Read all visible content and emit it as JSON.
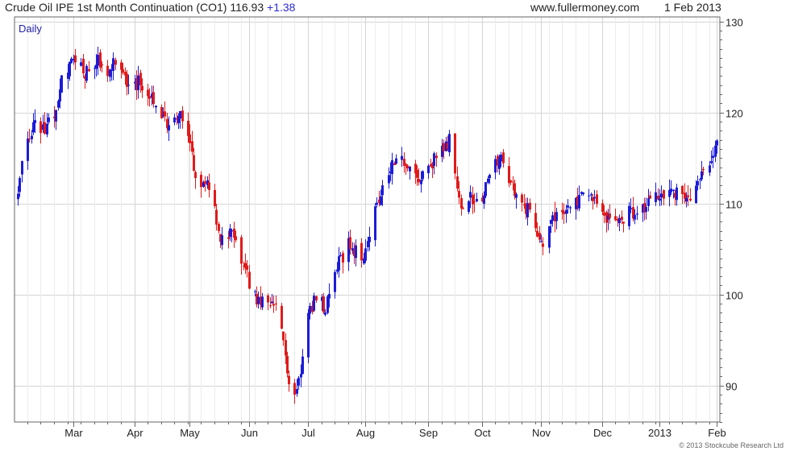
{
  "header": {
    "title": "Crude Oil IPE 1st Month Continuation (CO1) 116.93",
    "change": "+1.38",
    "site": "www.fullermoney.com",
    "date": "1 Feb 2013"
  },
  "footer": {
    "copyright": "© 2013 Stockcube Research Ltd"
  },
  "colors": {
    "up": "#1c1cd8",
    "down": "#e01b1b",
    "grid": "#d4d4d4",
    "frame": "#666666"
  },
  "chart_data": {
    "type": "candlestick",
    "period_label": "Daily",
    "xlabel": "",
    "ylabel": "",
    "ylim": [
      86,
      130.5
    ],
    "yticks": [
      90,
      100,
      110,
      120,
      130
    ],
    "y_axis_side": "right",
    "grid": true,
    "start_date": "2012-02-01",
    "end_date": "2013-02-01",
    "x_tick_labels": [
      {
        "label": "Mar",
        "date": "2012-03-01"
      },
      {
        "label": "Apr",
        "date": "2012-04-02"
      },
      {
        "label": "May",
        "date": "2012-05-01"
      },
      {
        "label": "Jun",
        "date": "2012-06-01"
      },
      {
        "label": "Jul",
        "date": "2012-07-02"
      },
      {
        "label": "Aug",
        "date": "2012-08-01"
      },
      {
        "label": "Sep",
        "date": "2012-09-03"
      },
      {
        "label": "Oct",
        "date": "2012-10-01"
      },
      {
        "label": "Nov",
        "date": "2012-11-01"
      },
      {
        "label": "Dec",
        "date": "2012-12-03"
      },
      {
        "label": "2013",
        "date": "2013-01-02"
      },
      {
        "label": "Feb",
        "date": "2013-02-01"
      }
    ],
    "close_path": [
      [
        "2012-02-01",
        111.5
      ],
      [
        "2012-02-06",
        117.5
      ],
      [
        "2012-02-10",
        118.6
      ],
      [
        "2012-02-15",
        118.0
      ],
      [
        "2012-02-20",
        120.0
      ],
      [
        "2012-02-24",
        123.5
      ],
      [
        "2012-03-01",
        126.5
      ],
      [
        "2012-03-07",
        124.0
      ],
      [
        "2012-03-13",
        126.0
      ],
      [
        "2012-03-19",
        124.5
      ],
      [
        "2012-03-23",
        125.5
      ],
      [
        "2012-03-30",
        122.5
      ],
      [
        "2012-04-05",
        123.5
      ],
      [
        "2012-04-12",
        121.0
      ],
      [
        "2012-04-19",
        118.5
      ],
      [
        "2012-04-27",
        119.8
      ],
      [
        "2012-05-04",
        113.0
      ],
      [
        "2012-05-11",
        112.0
      ],
      [
        "2012-05-17",
        106.5
      ],
      [
        "2012-05-24",
        106.5
      ],
      [
        "2012-05-31",
        102.0
      ],
      [
        "2012-06-05",
        99.0
      ],
      [
        "2012-06-12",
        99.5
      ],
      [
        "2012-06-18",
        97.0
      ],
      [
        "2012-06-22",
        90.5
      ],
      [
        "2012-06-25",
        89.2
      ],
      [
        "2012-06-28",
        91.5
      ],
      [
        "2012-07-02",
        97.5
      ],
      [
        "2012-07-06",
        100.0
      ],
      [
        "2012-07-11",
        98.5
      ],
      [
        "2012-07-17",
        103.0
      ],
      [
        "2012-07-23",
        105.5
      ],
      [
        "2012-07-30",
        104.0
      ],
      [
        "2012-08-03",
        107.0
      ],
      [
        "2012-08-09",
        111.5
      ],
      [
        "2012-08-16",
        115.0
      ],
      [
        "2012-08-23",
        114.5
      ],
      [
        "2012-08-29",
        112.5
      ],
      [
        "2012-09-05",
        114.5
      ],
      [
        "2012-09-11",
        116.0
      ],
      [
        "2012-09-14",
        117.0
      ],
      [
        "2012-09-19",
        110.0
      ],
      [
        "2012-09-25",
        110.5
      ],
      [
        "2012-10-02",
        111.0
      ],
      [
        "2012-10-08",
        115.0
      ],
      [
        "2012-10-12",
        114.5
      ],
      [
        "2012-10-19",
        111.0
      ],
      [
        "2012-10-26",
        109.0
      ],
      [
        "2012-11-02",
        105.5
      ],
      [
        "2012-11-09",
        109.0
      ],
      [
        "2012-11-15",
        109.5
      ],
      [
        "2012-11-21",
        110.5
      ],
      [
        "2012-11-28",
        110.8
      ],
      [
        "2012-12-05",
        108.5
      ],
      [
        "2012-12-11",
        108.0
      ],
      [
        "2012-12-17",
        109.0
      ],
      [
        "2012-12-24",
        109.5
      ],
      [
        "2012-12-31",
        111.0
      ],
      [
        "2013-01-07",
        111.5
      ],
      [
        "2013-01-14",
        111.0
      ],
      [
        "2013-01-18",
        110.5
      ],
      [
        "2013-01-23",
        112.5
      ],
      [
        "2013-01-28",
        114.0
      ],
      [
        "2013-02-01",
        116.9
      ]
    ],
    "last_close": 116.93,
    "last_change": 1.38
  }
}
